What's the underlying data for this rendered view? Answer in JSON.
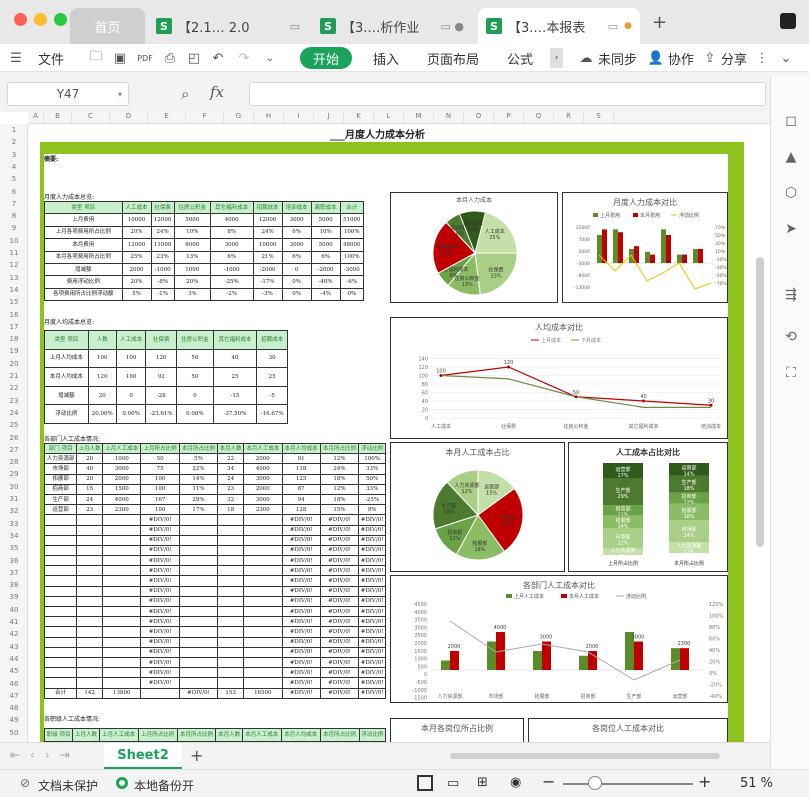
{
  "tabs": [
    {
      "label": "首页"
    },
    {
      "label": "【2.1… 2.0"
    },
    {
      "label": "【3.…析作业"
    },
    {
      "label": "【3.…本报表"
    }
  ],
  "menu": {
    "file": "文件",
    "start": "开始",
    "insert": "插入",
    "page_layout": "页面布局",
    "formula": "公式",
    "unsynced": "未同步",
    "collaborate": "协作",
    "share": "分享"
  },
  "formula_bar": {
    "cell_ref": "Y47",
    "fx": "fx",
    "value": ""
  },
  "columns": [
    "A",
    "B",
    "C",
    "D",
    "E",
    "F",
    "G",
    "H",
    "I",
    "J",
    "K",
    "L",
    "M",
    "N",
    "O",
    "P",
    "Q",
    "R",
    "S"
  ],
  "rows": [
    "1",
    "2",
    "3",
    "4",
    "5",
    "6",
    "7",
    "8",
    "9",
    "10",
    "11",
    "12",
    "13",
    "14",
    "15",
    "16",
    "17",
    "18",
    "19",
    "20",
    "21",
    "22",
    "23",
    "24",
    "25",
    "26",
    "27",
    "28",
    "29",
    "30",
    "31",
    "32",
    "33",
    "34",
    "35",
    "36",
    "37",
    "38",
    "39",
    "40",
    "41",
    "42",
    "43",
    "44",
    "45",
    "46",
    "47",
    "48",
    "49",
    "50"
  ],
  "sheet": {
    "title": "___月度人力成本分析",
    "summary_label": "摘要:",
    "sec1": "月度人力成本总览:",
    "sec2": "月度人均成本总览:",
    "sec3": "各部门人工成本情况:",
    "sec4": "各职级人工成本情况:"
  },
  "table1": {
    "headers": [
      "类型 项目",
      "人工成本",
      "社保费",
      "住房公积金",
      "其它福利成本",
      "招聘成本",
      "培训成本",
      "离职成本",
      "合计"
    ],
    "rows": [
      [
        "上月费用",
        "10000",
        "12000",
        "5000",
        "4000",
        "12000",
        "3000",
        "5000",
        "51000"
      ],
      [
        "上月各项费用所占比例",
        "20%",
        "24%",
        "10%",
        "8%",
        "24%",
        "6%",
        "10%",
        "100%"
      ],
      [
        "本月费用",
        "12000",
        "11000",
        "6000",
        "3000",
        "10000",
        "3000",
        "5000",
        "48000"
      ],
      [
        "本月各项费用所占比例",
        "25%",
        "23%",
        "13%",
        "6%",
        "21%",
        "6%",
        "6%",
        "100%"
      ],
      [
        "增减额",
        "2000",
        "-1000",
        "1000",
        "-1000",
        "-2000",
        "0",
        "-2000",
        "-3000"
      ],
      [
        "费用浮动比例",
        "20%",
        "-8%",
        "20%",
        "-25%",
        "-17%",
        "0%",
        "-40%",
        "-6%"
      ],
      [
        "各项费用所占比例浮动额",
        "5%",
        "-1%",
        "3%",
        "-2%",
        "-3%",
        "0%",
        "-4%",
        "0%"
      ]
    ]
  },
  "table2": {
    "headers": [
      "类型 项目",
      "人数",
      "人工成本",
      "社保费",
      "住房公积金",
      "其它福利成本",
      "招聘成本"
    ],
    "rows": [
      [
        "上月人均成本",
        "100",
        "100",
        "120",
        "50",
        "40",
        "30"
      ],
      [
        "本月人均成本",
        "120",
        "100",
        "92",
        "50",
        "25",
        "25"
      ],
      [
        "增减额",
        "20",
        "0",
        "-28",
        "0",
        "-15",
        "-5"
      ],
      [
        "浮动比例",
        "20.00%",
        "0.00%",
        "-23.61%",
        "0.00%",
        "-37.50%",
        "-16.67%"
      ]
    ]
  },
  "table3": {
    "headers": [
      "部门 项目",
      "上月人数",
      "上月人工成本",
      "上月所占比例",
      "本月所占比例",
      "本月人数",
      "本月人工成本",
      "本月人均成本",
      "本月所占比例",
      "浮动比例"
    ],
    "rows": [
      [
        "人力资源部",
        "20",
        "1000",
        "50",
        "5%",
        "22",
        "2000",
        "91",
        "12%",
        "100%"
      ],
      [
        "市场部",
        "40",
        "3000",
        "75",
        "22%",
        "34",
        "4000",
        "118",
        "24%",
        "33%"
      ],
      [
        "拓展部",
        "20",
        "2000",
        "100",
        "14%",
        "24",
        "3000",
        "125",
        "18%",
        "50%"
      ],
      [
        "招商部",
        "15",
        "1500",
        "100",
        "11%",
        "23",
        "2000",
        "87",
        "12%",
        "33%"
      ],
      [
        "生产部",
        "24",
        "4000",
        "167",
        "29%",
        "32",
        "3000",
        "94",
        "18%",
        "-25%"
      ],
      [
        "运营部",
        "23",
        "2300",
        "100",
        "17%",
        "18",
        "2300",
        "128",
        "15%",
        "9%"
      ]
    ],
    "div_error": "#DIV/0!",
    "total_row": [
      "合计",
      "142",
      "13800",
      "",
      "#DIV/0!",
      "153",
      "16500",
      "#DIV/0!",
      "#DIV/0!",
      "#DIV/0!"
    ]
  },
  "charts": {
    "pie1": {
      "title": "本月人力成本",
      "labels": [
        "人工成本 25%",
        "社保费 23%",
        "住房公积金 13%",
        "其它福利成本 6%",
        "招聘成本 21%",
        "培训成本 6%",
        "离职成本 10%"
      ]
    },
    "combo1": {
      "title": "月度人力成本对比",
      "legend": [
        "上月费用",
        "本月费用",
        "浮动比例"
      ]
    },
    "line1": {
      "title": "人均成本对比",
      "legend": [
        "上月成本",
        "下月成本"
      ],
      "categories": [
        "人工成本",
        "社保费",
        "住房公积金",
        "其它福利成本",
        "培训成本"
      ],
      "labels": [
        "100",
        "120",
        "50",
        "40",
        "30"
      ]
    },
    "pie2": {
      "title": "本月人工成本占比",
      "labels": [
        "运营部 15%",
        "市场部 25%",
        "拓展部 18%",
        "招商部 12%",
        "生产部 18%",
        "人力资源部 12%"
      ]
    },
    "stack": {
      "title": "人工成本占比对比",
      "x": [
        "上月所占比例",
        "本月所占比例"
      ],
      "labels": [
        "运营部 17%",
        "生产部 29%",
        "招商部 11%",
        "拓展部 14%",
        "市场部 22%",
        "人力资源部 7%",
        "运营部 14%",
        "生产部 18%",
        "招商部 12%",
        "拓展部 18%",
        "市场部 24%",
        "人力资源部 12%"
      ]
    },
    "combo2": {
      "title": "各部门人工成本对比",
      "legend": [
        "上月人工成本",
        "本月人工成本",
        "浮动比例"
      ],
      "categories": [
        "人力资源部",
        "市场部",
        "拓展部",
        "招商部",
        "生产部",
        "运营部"
      ],
      "bar_labels": [
        "2000",
        "4000",
        "3000",
        "2000",
        "3000",
        "2300"
      ],
      "y_ticks": [
        "4500",
        "4000",
        "3500",
        "3000",
        "2500",
        "2000",
        "1500",
        "1000",
        "500",
        "0",
        "-500",
        "-1000",
        "-1500"
      ],
      "y2_ticks": [
        "120%",
        "100%",
        "80%",
        "60%",
        "40%",
        "20%",
        "0%",
        "-20%",
        "-40%"
      ]
    },
    "pie3": {
      "title": "本月各岗位所占比例"
    },
    "combo3": {
      "title": "各岗位人工成本对比"
    }
  },
  "sheet_tab": "Sheet2",
  "status": {
    "protect": "文档未保护",
    "backup": "本地备份开",
    "zoom": "51 %"
  },
  "colors": {
    "accent": "#1aa35b",
    "frame": "#8dc21f",
    "bar_green": "#5b8c2a",
    "bar_red": "#c00000",
    "header_green": "#c9f0cd"
  }
}
